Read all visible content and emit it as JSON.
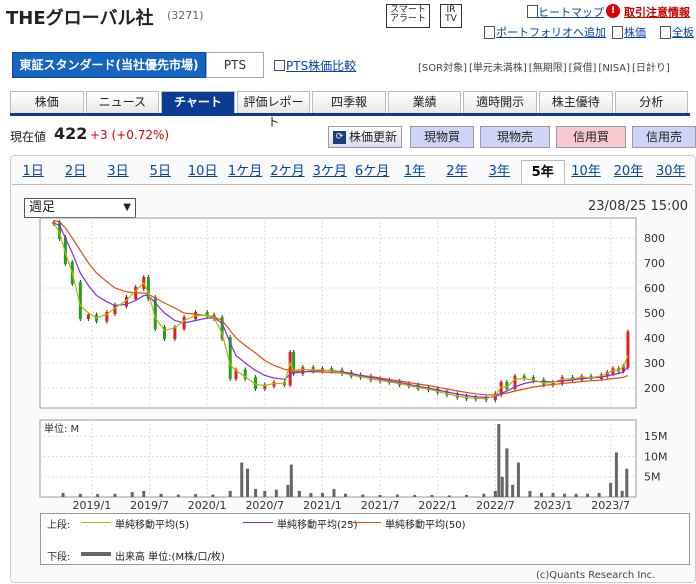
{
  "header": {
    "company": "THEグローバル社",
    "code": "(3271)",
    "smart_alert": [
      "スマート",
      "アラート"
    ],
    "ir_tv": [
      "IR",
      "TV"
    ],
    "heatmap": "ヒートマップ",
    "caution": "取引注意情報",
    "portfolio_add": "ポートフォリオへ追加",
    "stock_price_link": "株価",
    "full_board": "全板"
  },
  "market": {
    "primary": "東証スタンダード(当社優先市場)",
    "pts": "PTS",
    "pts_compare": "PTS株価比較",
    "tags": [
      "[SOR対象]",
      "[単元未満株]",
      "[無期限]",
      "[貸借]",
      "[NISA]",
      "[日計り]"
    ]
  },
  "nav": [
    "株価",
    "ニュース",
    "チャート",
    "評価レポート",
    "四季報",
    "業績",
    "適時開示",
    "株主優待",
    "分析"
  ],
  "quote": {
    "label": "現在値",
    "price": "422",
    "change": "+3 (+0.72%)",
    "refresh": "株価更新",
    "buy_cash": "現物買",
    "sell_cash": "現物売",
    "buy_margin": "信用買",
    "sell_margin": "信用売"
  },
  "periods": [
    "1日",
    "2日",
    "3日",
    "5日",
    "10日",
    "1ケ月",
    "2ケ月",
    "3ケ月",
    "6ケ月",
    "1年",
    "2年",
    "3年",
    "5年",
    "10年",
    "20年",
    "30年"
  ],
  "active_period": "5年",
  "interval_select": "週足",
  "timestamp": "23/08/25 15:00",
  "legend": {
    "upper_label": "上段:",
    "ma5": "単純移動平均(5)",
    "ma25": "単純移動平均(25)",
    "ma50": "単純移動平均(50)",
    "lower_label": "下段:",
    "volume": "出来高 単位:(M株/口/枚)",
    "colors": {
      "ma5": "#b5b500",
      "ma25": "#8a2be2",
      "ma50": "#e05010",
      "volume": "#666666"
    }
  },
  "copyright": "(c)Quants Research Inc.",
  "chart_data": {
    "type": "line",
    "price_axis": {
      "ticks": [
        "800",
        "700",
        "600",
        "500",
        "400",
        "300",
        "200"
      ],
      "ylim": [
        120,
        880
      ]
    },
    "volume_axis": {
      "unit_label": "単位: M",
      "ticks": [
        "15M",
        "10M",
        "5M"
      ],
      "ylim": [
        0,
        19
      ]
    },
    "x_ticks": [
      "2019/1",
      "2019/7",
      "2020/1",
      "2020/7",
      "2021/1",
      "2021/7",
      "2022/1",
      "2022/7",
      "2023/1",
      "2023/7"
    ],
    "x_tick_times": [
      2019.0,
      2019.5,
      2020.0,
      2020.5,
      2021.0,
      2021.5,
      2022.0,
      2022.5,
      2023.0,
      2023.5
    ],
    "price": {
      "t": [
        2018.67,
        2018.72,
        2018.77,
        2018.83,
        2018.9,
        2018.97,
        2019.04,
        2019.13,
        2019.2,
        2019.3,
        2019.38,
        2019.45,
        2019.49,
        2019.55,
        2019.63,
        2019.72,
        2019.8,
        2019.9,
        2020.0,
        2020.06,
        2020.13,
        2020.2,
        2020.25,
        2020.33,
        2020.42,
        2020.5,
        2020.58,
        2020.67,
        2020.72,
        2020.75,
        2020.83,
        2020.92,
        2021.0,
        2021.08,
        2021.17,
        2021.25,
        2021.33,
        2021.42,
        2021.5,
        2021.58,
        2021.67,
        2021.75,
        2021.83,
        2021.92,
        2022.0,
        2022.08,
        2022.17,
        2022.25,
        2022.33,
        2022.42,
        2022.5,
        2022.55,
        2022.6,
        2022.67,
        2022.75,
        2022.83,
        2022.92,
        2023.0,
        2023.08,
        2023.17,
        2023.25,
        2023.33,
        2023.42,
        2023.47,
        2023.52,
        2023.57,
        2023.61,
        2023.65
      ],
      "close": [
        860,
        800,
        700,
        620,
        480,
        490,
        470,
        500,
        530,
        560,
        600,
        640,
        560,
        440,
        400,
        440,
        480,
        500,
        490,
        480,
        400,
        240,
        270,
        240,
        200,
        210,
        220,
        215,
        340,
        260,
        280,
        270,
        275,
        270,
        260,
        250,
        245,
        235,
        230,
        225,
        215,
        210,
        200,
        195,
        185,
        175,
        165,
        160,
        158,
        155,
        175,
        220,
        200,
        245,
        240,
        230,
        215,
        220,
        240,
        235,
        245,
        240,
        250,
        260,
        275,
        270,
        285,
        422
      ]
    },
    "ma5": [
      860,
      820,
      740,
      660,
      530,
      500,
      480,
      495,
      520,
      550,
      590,
      620,
      580,
      480,
      430,
      440,
      470,
      490,
      490,
      480,
      420,
      290,
      270,
      245,
      215,
      210,
      218,
      218,
      300,
      270,
      275,
      272,
      272,
      268,
      260,
      252,
      245,
      237,
      230,
      225,
      217,
      210,
      202,
      196,
      187,
      177,
      168,
      162,
      159,
      157,
      170,
      205,
      205,
      235,
      238,
      232,
      220,
      222,
      236,
      236,
      244,
      241,
      249,
      258,
      270,
      272,
      285,
      330
    ],
    "ma25": [
      860,
      850,
      800,
      740,
      660,
      610,
      570,
      545,
      530,
      535,
      550,
      570,
      570,
      540,
      500,
      470,
      460,
      470,
      480,
      480,
      460,
      380,
      330,
      300,
      270,
      250,
      240,
      235,
      255,
      260,
      265,
      268,
      270,
      270,
      265,
      258,
      250,
      243,
      236,
      229,
      222,
      215,
      207,
      200,
      192,
      184,
      176,
      170,
      165,
      162,
      165,
      178,
      188,
      205,
      218,
      226,
      226,
      224,
      228,
      232,
      238,
      240,
      244,
      248,
      254,
      258,
      264,
      285
    ],
    "ma50": [
      870,
      865,
      840,
      800,
      750,
      700,
      660,
      625,
      600,
      585,
      580,
      580,
      575,
      560,
      540,
      520,
      500,
      495,
      490,
      485,
      470,
      430,
      400,
      370,
      340,
      310,
      290,
      275,
      270,
      268,
      266,
      265,
      264,
      262,
      260,
      256,
      251,
      246,
      240,
      234,
      228,
      222,
      216,
      210,
      203,
      196,
      189,
      182,
      177,
      173,
      172,
      176,
      180,
      188,
      196,
      204,
      210,
      214,
      218,
      222,
      226,
      229,
      232,
      235,
      238,
      240,
      243,
      250
    ],
    "volume": {
      "t": [
        2018.75,
        2018.9,
        2019.05,
        2019.2,
        2019.35,
        2019.45,
        2019.6,
        2019.75,
        2019.9,
        2020.05,
        2020.2,
        2020.3,
        2020.35,
        2020.42,
        2020.5,
        2020.6,
        2020.7,
        2020.73,
        2020.8,
        2020.9,
        2021.0,
        2021.1,
        2021.2,
        2021.35,
        2021.5,
        2021.65,
        2021.8,
        2021.95,
        2022.1,
        2022.25,
        2022.4,
        2022.5,
        2022.53,
        2022.56,
        2022.6,
        2022.65,
        2022.7,
        2022.8,
        2022.9,
        2023.0,
        2023.1,
        2023.2,
        2023.3,
        2023.4,
        2023.5,
        2023.55,
        2023.6,
        2023.64
      ],
      "values": [
        1.0,
        0.8,
        0.7,
        0.8,
        1.2,
        1.5,
        0.8,
        0.6,
        0.7,
        0.6,
        1.5,
        8.5,
        7.0,
        2.0,
        1.5,
        1.8,
        3.0,
        8.0,
        1.5,
        1.0,
        1.0,
        2.0,
        0.8,
        0.6,
        0.5,
        0.6,
        0.5,
        0.5,
        0.4,
        0.5,
        0.8,
        1.5,
        18.0,
        5.0,
        12.0,
        3.0,
        8.5,
        1.5,
        1.0,
        1.0,
        0.8,
        0.8,
        0.8,
        1.0,
        3.5,
        11.0,
        1.5,
        7.0
      ]
    }
  }
}
